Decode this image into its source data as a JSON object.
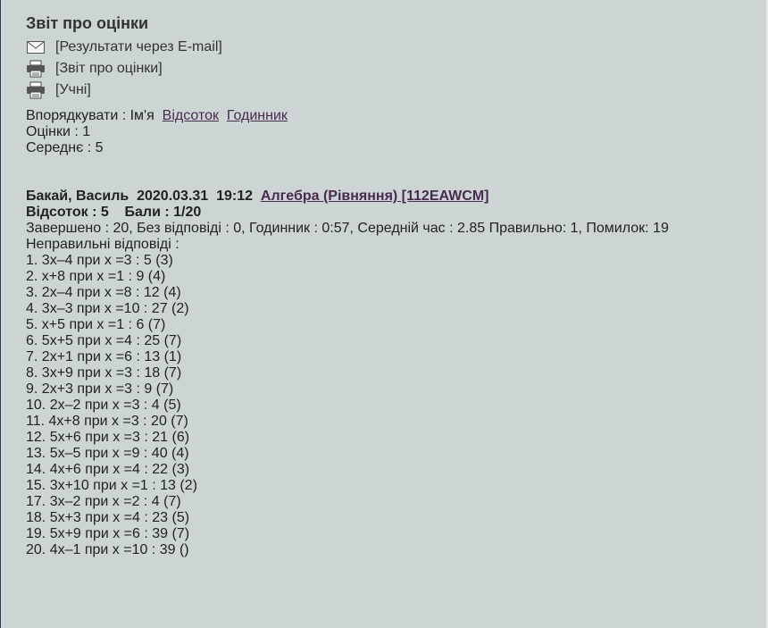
{
  "title": "Звіт про оцінки",
  "menu": [
    {
      "icon": "envelope-icon",
      "label": "[Результати через E-mail]"
    },
    {
      "icon": "printer-icon",
      "label": "[Звіт про оцінки]"
    },
    {
      "icon": "printer-icon",
      "label": "[Учні]"
    }
  ],
  "sort": {
    "prefix": "Впорядкувати : Ім'я",
    "percent_link": "Відсоток",
    "timer_link": "Годинник"
  },
  "summary": {
    "grades": "Оцінки : 1",
    "average": "Середнє : 5"
  },
  "student": {
    "name_date": "Бакай, Василь  2020.03.31  19:12",
    "test_link": "Алгебра (Рівняння) [112EAWCM]",
    "score_line": "Відсоток : 5    Бали : 1/20",
    "stats": "Завершено : 20, Без відповіді : 0, Годинник : 0:57, Середній час : 2.85 Правильно: 1, Помилок: 19",
    "wrong_header": "Неправильні відповіді :",
    "wrong_answers": [
      "1. 3x–4 при x =3 : 5 (3)",
      "2. x+8 при x =1 : 9 (4)",
      "3. 2x–4 при x =8 : 12 (4)",
      "4. 3x–3 при x =10 : 27 (2)",
      "5. x+5 при x =1 : 6 (7)",
      "6. 5x+5 при x =4 : 25 (7)",
      "7. 2x+1 при x =6 : 13 (1)",
      "8. 3x+9 при x =3 : 18 (7)",
      "9. 2x+3 при x =3 : 9 (7)",
      "10. 2x–2 при x =3 : 4 (5)",
      "11. 4x+8 при x =3 : 20 (7)",
      "12. 5x+6 при x =3 : 21 (6)",
      "13. 5x–5 при x =9 : 40 (4)",
      "14. 4x+6 при x =4 : 22 (3)",
      "15. 3x+10 при x =1 : 13 (2)",
      "17. 3x–2 при x =2 : 4 (7)",
      "18. 5x+3 при x =4 : 23 (5)",
      "19. 5x+9 при x =6 : 39 (7)",
      "20. 4x–1 при x =10 : 39 ()"
    ]
  }
}
